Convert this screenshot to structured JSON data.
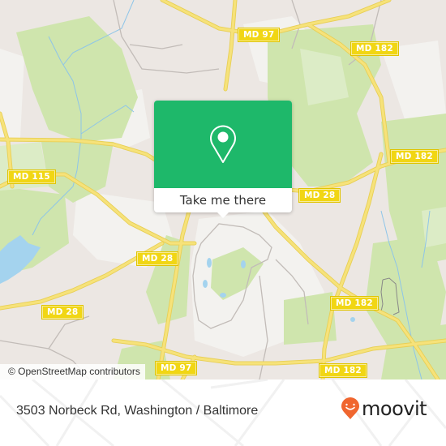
{
  "map": {
    "colors": {
      "land": "#ece7e3",
      "forest": "#cfe5ad",
      "forest_light": "#dcecc6",
      "residential_light": "#f3f2ef",
      "water": "#a4d3ee",
      "road_major": "#f6e27a",
      "road_minor": "#c2bcb8",
      "shield_bg": "#f1d614"
    },
    "road_labels": [
      {
        "id": "md97-north",
        "text": "MD 97"
      },
      {
        "id": "md182-north",
        "text": "MD 182"
      },
      {
        "id": "md182-east",
        "text": "MD 182"
      },
      {
        "id": "md115",
        "text": "MD 115"
      },
      {
        "id": "md28-east",
        "text": "MD 28"
      },
      {
        "id": "md28-center",
        "text": "MD 28"
      },
      {
        "id": "md28-west",
        "text": "MD 28"
      },
      {
        "id": "md182-southeast",
        "text": "MD 182"
      },
      {
        "id": "md97-south",
        "text": "MD 97"
      },
      {
        "id": "md182-south",
        "text": "MD 182"
      }
    ],
    "attribution": "© OpenStreetMap contributors"
  },
  "popup": {
    "icon": "location-pin-icon",
    "button_label": "Take me there",
    "color": "#1eb86a"
  },
  "footer": {
    "address": "3503 Norbeck Rd, Washington / Baltimore",
    "brand": {
      "name": "moovit",
      "icon": "moovit-smiley-pin-icon",
      "color": "#f0662f"
    }
  }
}
